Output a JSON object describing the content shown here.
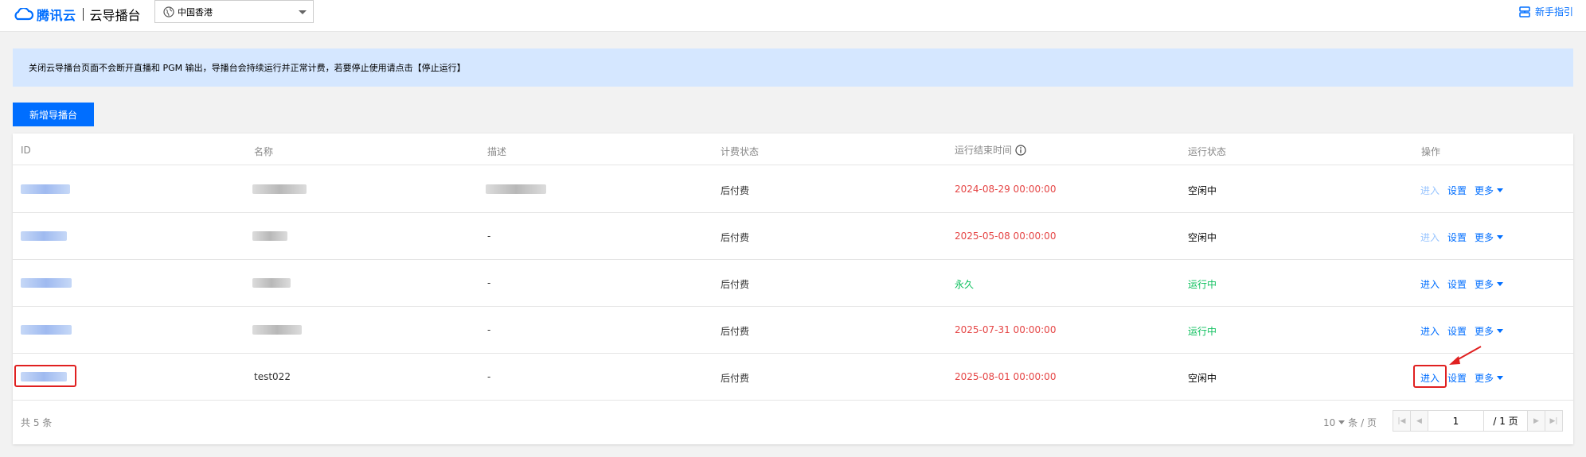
{
  "header": {
    "brand": "腾讯云",
    "product": "云导播台",
    "region": "中国香港",
    "guide_label": "新手指引"
  },
  "notice": {
    "text": "关闭云导播台页面不会断开直播和 PGM 输出，导播台会持续运行并正常计费，若要停止使用请点击【停止运行】"
  },
  "toolbar": {
    "create_label": "新增导播台"
  },
  "table": {
    "columns": [
      "ID",
      "名称",
      "描述",
      "计费状态",
      "运行结束时间",
      "运行状态",
      "操作"
    ],
    "rows": [
      {
        "id": "",
        "name": "",
        "desc": "",
        "billing": "后付费",
        "end_time": "2024-08-29 00:00:00",
        "end_status": "expired",
        "status": "空闲中",
        "status_type": "idle",
        "enter_enabled": false
      },
      {
        "id": "",
        "name": "",
        "desc": "-",
        "billing": "后付费",
        "end_time": "2025-05-08 00:00:00",
        "end_status": "expired",
        "status": "空闲中",
        "status_type": "idle",
        "enter_enabled": false
      },
      {
        "id": "",
        "name": "",
        "desc": "-",
        "billing": "后付费",
        "end_time": "永久",
        "end_status": "permanent",
        "status": "运行中",
        "status_type": "running",
        "enter_enabled": true
      },
      {
        "id": "",
        "name": "",
        "desc": "-",
        "billing": "后付费",
        "end_time": "2025-07-31 00:00:00",
        "end_status": "expired",
        "status": "运行中",
        "status_type": "running",
        "enter_enabled": true
      },
      {
        "id": "",
        "name": "test022",
        "desc": "-",
        "billing": "后付费",
        "end_time": "2025-08-01 00:00:00",
        "end_status": "expired",
        "status": "空闲中",
        "status_type": "idle",
        "enter_enabled": true
      }
    ],
    "actions": {
      "enter": "进入",
      "settings": "设置",
      "more": "更多"
    }
  },
  "pagination": {
    "total": "共 5 条",
    "page_size": "10",
    "page_size_suffix": "条 / 页",
    "current_page": "1",
    "total_pages": "/ 1 页"
  },
  "colors": {
    "accent": "#006eff",
    "danger": "#e54545",
    "success": "#0abf5b",
    "highlight": "#e02020"
  }
}
